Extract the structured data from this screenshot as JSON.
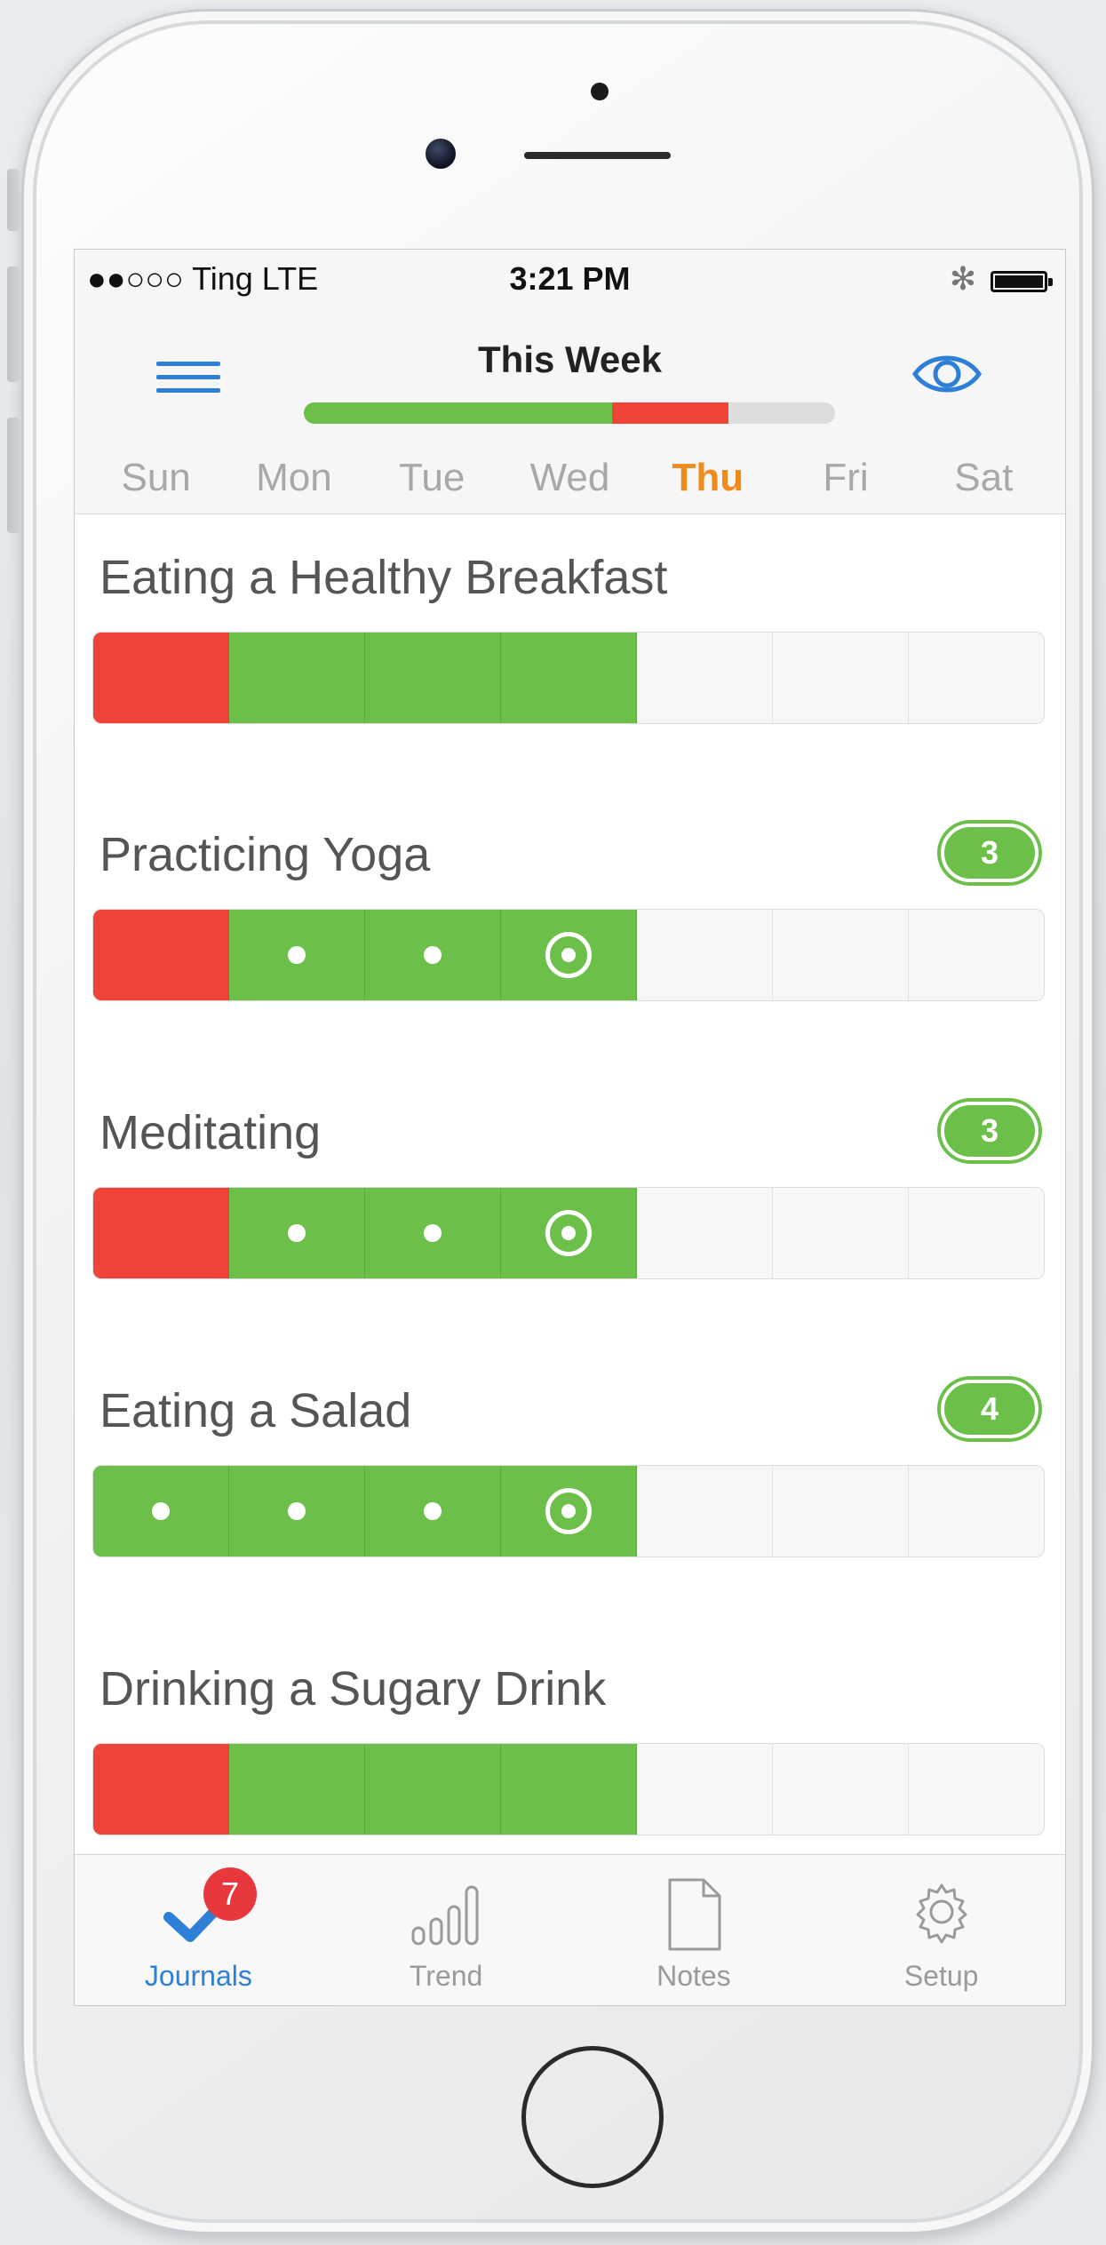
{
  "status_bar": {
    "carrier": "●●○○○ Ting  LTE",
    "time": "3:21 PM",
    "bluetooth": "✻"
  },
  "header": {
    "title": "This Week",
    "week_progress": {
      "green_fraction": 0.58,
      "red_fraction": 0.22
    },
    "menu_icon": "hamburger-icon",
    "view_icon": "eye-icon"
  },
  "days": [
    "Sun",
    "Mon",
    "Tue",
    "Wed",
    "Thu",
    "Fri",
    "Sat"
  ],
  "today_index": 4,
  "habits": [
    {
      "name": "Eating a Healthy Breakfast",
      "badge": null,
      "cells": [
        "red",
        "green",
        "green",
        "green",
        "empty",
        "empty",
        "empty"
      ],
      "marks": [
        "",
        "",
        "",
        "",
        "",
        "",
        ""
      ]
    },
    {
      "name": "Practicing Yoga",
      "badge": "3",
      "cells": [
        "red",
        "green",
        "green",
        "green",
        "empty",
        "empty",
        "empty"
      ],
      "marks": [
        "",
        "dot",
        "dot",
        "target",
        "",
        "",
        ""
      ]
    },
    {
      "name": "Meditating",
      "badge": "3",
      "cells": [
        "red",
        "green",
        "green",
        "green",
        "empty",
        "empty",
        "empty"
      ],
      "marks": [
        "",
        "dot",
        "dot",
        "target",
        "",
        "",
        ""
      ]
    },
    {
      "name": "Eating a Salad",
      "badge": "4",
      "cells": [
        "green",
        "green",
        "green",
        "green",
        "empty",
        "empty",
        "empty"
      ],
      "marks": [
        "dot",
        "dot",
        "dot",
        "target",
        "",
        "",
        ""
      ]
    },
    {
      "name": "Drinking a Sugary Drink",
      "badge": null,
      "cells": [
        "red",
        "green",
        "green",
        "green",
        "empty",
        "empty",
        "empty"
      ],
      "marks": [
        "",
        "",
        "",
        "",
        "",
        "",
        ""
      ]
    }
  ],
  "tabs": [
    {
      "label": "Journals",
      "icon": "checkmark-icon",
      "badge": "7",
      "active": true
    },
    {
      "label": "Trend",
      "icon": "trend-bars-icon",
      "badge": null,
      "active": false
    },
    {
      "label": "Notes",
      "icon": "note-page-icon",
      "badge": null,
      "active": false
    },
    {
      "label": "Setup",
      "icon": "gear-icon",
      "badge": null,
      "active": false
    }
  ],
  "colors": {
    "green": "#6cc04a",
    "red": "#f0443b",
    "accent": "#2e7fd6",
    "today": "#f08a1a"
  }
}
